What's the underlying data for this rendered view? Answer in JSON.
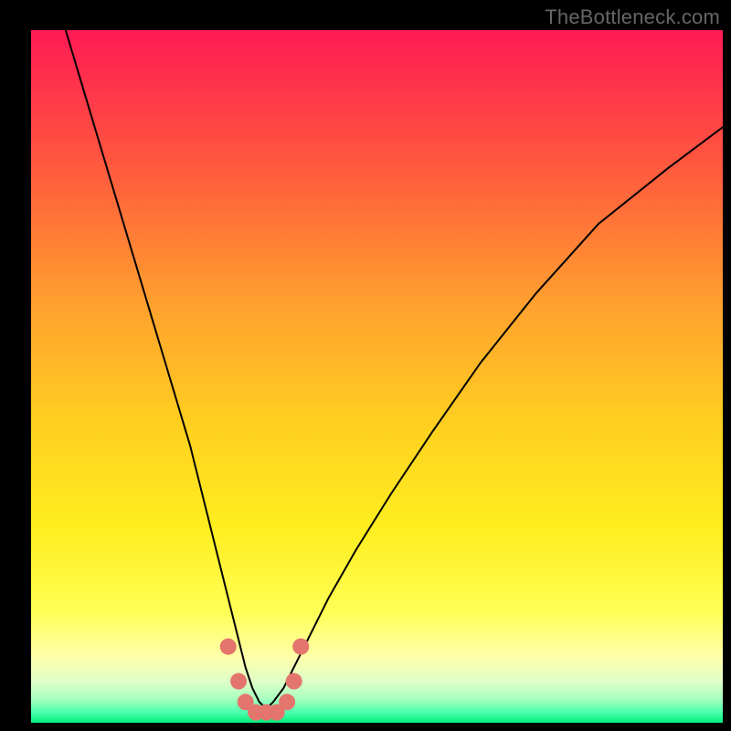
{
  "watermark": "TheBottleneck.com",
  "chart_data": {
    "type": "line",
    "title": "",
    "xlabel": "",
    "ylabel": "",
    "xlim": [
      0,
      100
    ],
    "ylim": [
      0,
      100
    ],
    "legend": false,
    "grid": false,
    "background_gradient": {
      "top": "#ff1a55",
      "mid_upper": "#ff9a2e",
      "mid": "#ffe021",
      "mid_lower": "#ffff66",
      "band1": "#f6ffb0",
      "band2": "#ccffcc",
      "bottom": "#00ff7f"
    },
    "series": [
      {
        "name": "curve",
        "color": "#000000",
        "linewidth": 2,
        "x": [
          5,
          8,
          11,
          14,
          17,
          20,
          23,
          25,
          27,
          28.5,
          30,
          31,
          32,
          33,
          34,
          35,
          36.5,
          38,
          40,
          43,
          47,
          52,
          58,
          65,
          73,
          82,
          92,
          100
        ],
        "y": [
          100,
          90,
          80,
          70,
          60,
          50,
          40,
          32,
          24,
          18,
          12,
          8,
          5,
          3,
          2,
          3,
          5,
          8,
          12,
          18,
          25,
          33,
          42,
          52,
          62,
          72,
          80,
          86
        ]
      }
    ],
    "markers": {
      "name": "points",
      "color": "#e3756d",
      "radius_px": 9,
      "x": [
        28.5,
        30.0,
        31.0,
        32.5,
        34.0,
        35.5,
        37.0,
        38.0,
        39.0
      ],
      "y": [
        11.0,
        6.0,
        3.0,
        1.5,
        1.5,
        1.5,
        3.0,
        6.0,
        11.0
      ]
    }
  }
}
